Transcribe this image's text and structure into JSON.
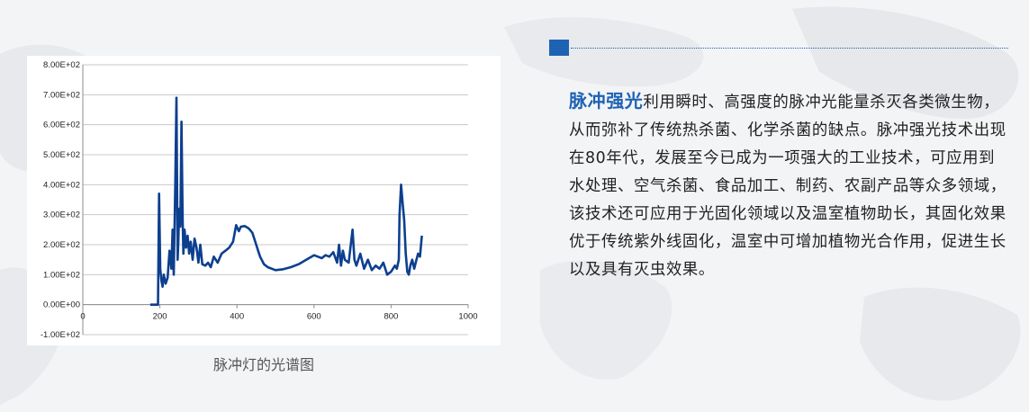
{
  "colors": {
    "accent": "#1e62b3",
    "series": "#0d3f8f",
    "text": "#222222"
  },
  "caption": "脉冲灯的光谱图",
  "text": {
    "highlight": "脉冲强光",
    "paragraph_rest": "利用瞬时、高强度的脉冲光能量杀灭各类微生物，从而弥补了传统热杀菌、化学杀菌的缺点。脉冲强光技术出现在80年代，发展至今已成为一项强大的工业技术，可应用到水处理、空气杀菌、食品加工、制药、农副产品等众多领域，该技术还可应用于光固化领域以及温室植物助长，其固化效果优于传统紫外线固化，温室中可增加植物光合作用，促进生长以及具有灭虫效果。"
  },
  "chart_data": {
    "type": "line",
    "xlim": [
      0,
      1000
    ],
    "ylim": [
      -100,
      800
    ],
    "x_ticks": [
      0,
      200,
      400,
      600,
      800,
      1000
    ],
    "x_tick_labels": [
      "0",
      "200",
      "400",
      "600",
      "800",
      "1000"
    ],
    "y_ticks": [
      800,
      700,
      600,
      500,
      400,
      300,
      200,
      100,
      0,
      -100
    ],
    "y_tick_labels": [
      "8.00E+02",
      "7.00E+02",
      "6.00E+02",
      "5.00E+02",
      "4.00E+02",
      "3.00E+02",
      "2.00E+02",
      "1.00E+02",
      "0.00E+00",
      "-1.00E+02"
    ],
    "grid": true,
    "legend": "none",
    "series": [
      {
        "x": [
          175,
          195,
          198,
          201,
          204,
          207,
          210,
          215,
          220,
          225,
          230,
          233,
          236,
          240,
          243,
          246,
          248,
          250,
          253,
          256,
          259,
          261,
          264,
          268,
          272,
          276,
          280,
          285,
          290,
          295,
          300,
          305,
          310,
          318,
          325,
          332,
          340,
          350,
          360,
          370,
          380,
          390,
          398,
          405,
          410,
          420,
          430,
          440,
          450,
          455,
          460,
          470,
          480,
          500,
          520,
          540,
          560,
          580,
          600,
          610,
          620,
          630,
          640,
          650,
          660,
          665,
          670,
          675,
          680,
          690,
          700,
          705,
          710,
          720,
          730,
          740,
          750,
          760,
          770,
          780,
          790,
          800,
          810,
          815,
          820,
          822,
          826,
          830,
          834,
          838,
          842,
          846,
          850,
          855,
          860,
          866,
          870,
          875,
          880
        ],
        "y": [
          0,
          0,
          370,
          120,
          80,
          60,
          100,
          70,
          90,
          180,
          120,
          250,
          100,
          400,
          690,
          150,
          210,
          320,
          260,
          610,
          280,
          170,
          250,
          190,
          230,
          170,
          210,
          150,
          220,
          190,
          140,
          200,
          135,
          130,
          140,
          125,
          160,
          140,
          170,
          180,
          190,
          210,
          265,
          245,
          260,
          262,
          255,
          240,
          200,
          180,
          160,
          135,
          125,
          115,
          118,
          125,
          135,
          150,
          165,
          160,
          155,
          165,
          160,
          175,
          140,
          200,
          130,
          180,
          150,
          140,
          250,
          150,
          130,
          170,
          120,
          150,
          115,
          130,
          120,
          140,
          100,
          110,
          130,
          120,
          150,
          300,
          400,
          340,
          280,
          170,
          110,
          100,
          130,
          150,
          120,
          150,
          170,
          160,
          230
        ]
      }
    ]
  }
}
